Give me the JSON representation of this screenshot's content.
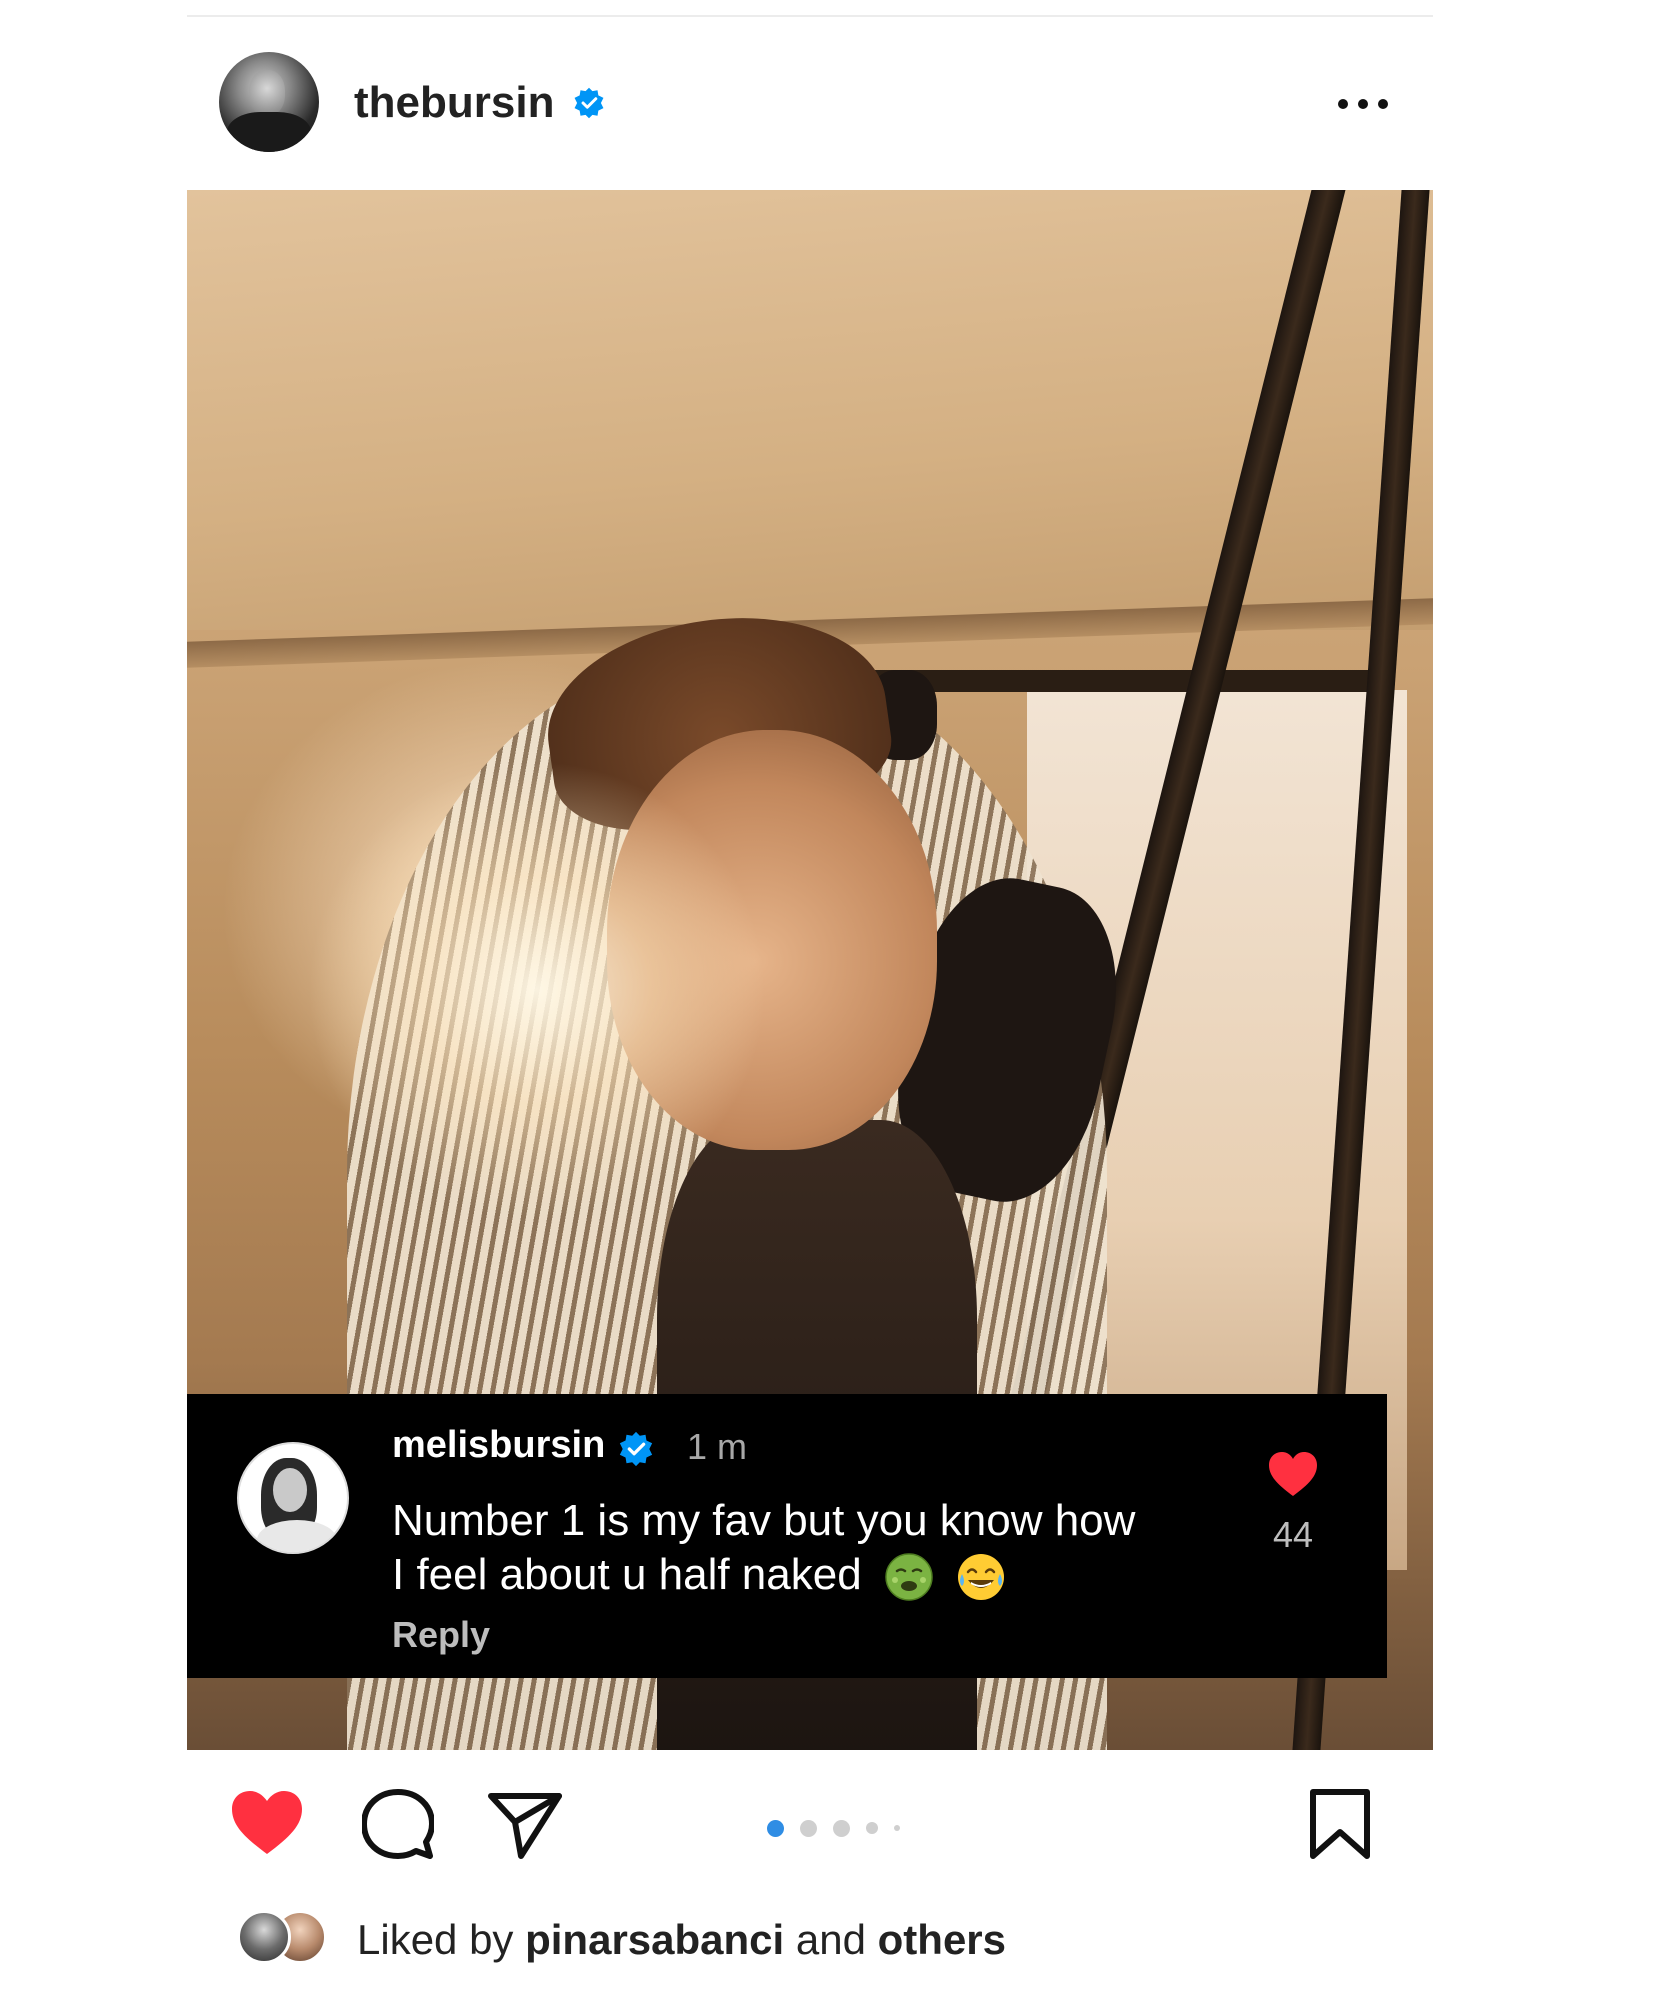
{
  "post": {
    "username": "thebursin",
    "verified": true
  },
  "comment": {
    "username": "melisbursin",
    "time": "1 m",
    "text_line1": "Number 1 is my fav but you know how",
    "text_line2": "I feel about u half naked",
    "emojis": [
      "nauseated-face",
      "face-with-tears-of-joy"
    ],
    "reply_label": "Reply",
    "like_count": "44"
  },
  "carousel": {
    "total_dots": 5,
    "active_index": 0
  },
  "likes": {
    "prefix": "Liked by",
    "user": "pinarsabanci",
    "middle": "and",
    "others": "others"
  },
  "colors": {
    "like_red": "#ff3040",
    "verified_blue": "#0095f6",
    "active_dot": "#2f8de4"
  }
}
